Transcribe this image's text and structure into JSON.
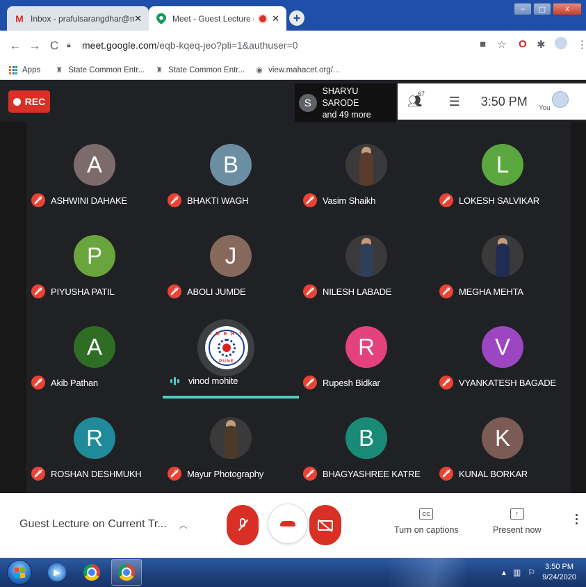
{
  "browser": {
    "tabs": [
      {
        "title": "Inbox - prafulsarangdhar@mmin",
        "favicon": "gmail-icon"
      },
      {
        "title": "Meet - Guest Lecture on Cur",
        "favicon": "meet-icon"
      }
    ],
    "new_tab": "+",
    "window_buttons": {
      "minimize": "–",
      "maximize": "▢",
      "close": "x"
    },
    "url_host": "meet.google.com",
    "url_path": "/eqb-kqeq-jeo?pli=1&authuser=0",
    "bookmarks": [
      {
        "label": "Apps",
        "icon": "apps-grid-icon"
      },
      {
        "label": "State Common Entr...",
        "icon": "emblem-icon"
      },
      {
        "label": "State Common Entr...",
        "icon": "emblem-icon"
      },
      {
        "label": "view.mahacet.org/...",
        "icon": "globe-icon"
      }
    ]
  },
  "meet": {
    "rec_label": "REC",
    "presenter": {
      "initial": "S",
      "name": "SHARYU SARODE",
      "more": "and 49 more"
    },
    "participant_count": "67",
    "time": "3:50 PM",
    "you_label": "You",
    "participants": [
      {
        "name": "ASHWINI DAHAKE",
        "initial": "A",
        "color": "#7c6b6a",
        "type": "initial",
        "muted": true
      },
      {
        "name": "BHAKTI WAGH",
        "initial": "B",
        "color": "#6b8ea3",
        "type": "initial",
        "muted": true
      },
      {
        "name": "Vasim Shaikh",
        "initial": "",
        "color": "#5a3b2e",
        "type": "photo",
        "muted": true
      },
      {
        "name": "LOKESH SALVIKAR",
        "initial": "L",
        "color": "#5aa73f",
        "type": "initial",
        "muted": true
      },
      {
        "name": "PIYUSHA PATIL",
        "initial": "P",
        "color": "#6aa43c",
        "type": "initial",
        "muted": true
      },
      {
        "name": "ABOLI JUMDE",
        "initial": "J",
        "color": "#87685d",
        "type": "initial",
        "muted": true
      },
      {
        "name": "NILESH LABADE",
        "initial": "",
        "color": "#2f3f5a",
        "type": "photo",
        "muted": true
      },
      {
        "name": "MEGHA MEHTA",
        "initial": "",
        "color": "#1f2d55",
        "type": "photo",
        "muted": true
      },
      {
        "name": "Akib Pathan",
        "initial": "A",
        "color": "#2f6d25",
        "type": "initial",
        "muted": true
      },
      {
        "name": "vinod mohite",
        "initial": "",
        "color": "#ffffff",
        "type": "logo",
        "muted": false,
        "speaking": true
      },
      {
        "name": "Rupesh Bidkar",
        "initial": "R",
        "color": "#e4427d",
        "type": "initial",
        "muted": true
      },
      {
        "name": "VYANKATESH BAGADE",
        "initial": "V",
        "color": "#9c46c2",
        "type": "initial",
        "muted": true
      },
      {
        "name": "ROSHAN DESHMUKH",
        "initial": "R",
        "color": "#1f8a9a",
        "type": "initial",
        "muted": true
      },
      {
        "name": "Mayur Photography",
        "initial": "",
        "color": "#4a3a2a",
        "type": "photo",
        "muted": true
      },
      {
        "name": "BHAGYASHREE KATRE",
        "initial": "B",
        "color": "#198a76",
        "type": "initial",
        "muted": true
      },
      {
        "name": "KUNAL BORKAR",
        "initial": "K",
        "color": "#7b5b54",
        "type": "initial",
        "muted": true
      }
    ],
    "logo_text": {
      "top": "I M E R T",
      "bottom": "PUNE"
    }
  },
  "controls": {
    "meeting_title": "Guest Lecture on Current Tr...",
    "captions_icon": "CC",
    "captions_label": "Turn on captions",
    "present_label": "Present now",
    "present_icon": "↑"
  },
  "taskbar": {
    "time": "3:50 PM",
    "date": "9/24/2020"
  },
  "colors": {
    "meet_bg": "#202124",
    "accent_red": "#d93025",
    "speaking": "#4ecdc4",
    "taskbar": "#1d3f7c"
  }
}
